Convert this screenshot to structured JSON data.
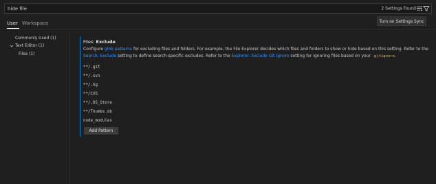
{
  "search": {
    "value": "hide file",
    "results_count": "2 Settings Found"
  },
  "tabs": [
    {
      "label": "User",
      "active": true
    },
    {
      "label": "Workspace",
      "active": false
    }
  ],
  "sync_button": {
    "label": "Turn on Settings Sync"
  },
  "toc": {
    "commonly_used": "Commonly Used (1)",
    "text_editor": "Text Editor (1)",
    "files": "Files (1)"
  },
  "setting": {
    "category": "Files: ",
    "name": "Exclude",
    "description": {
      "p1": "Configure ",
      "link1": "glob patterns",
      "p2": " for excluding files and folders. For example, the File Explorer decides which files and folders to show or hide based on this setting. Refer to the ",
      "link2": "Search: Exclude",
      "p3": " setting to define search-specific excludes. Refer to the ",
      "link3": "Explorer: Exclude Git Ignore",
      "p4": " setting for ignoring files based on your ",
      "code": ".gitignore",
      "p5": "."
    },
    "patterns": [
      "**/.git",
      "**/.svn",
      "**/.hg",
      "**/CVS",
      "**/.DS_Store",
      "**/Thumbs.db",
      "node_modules"
    ],
    "add_button": "Add Pattern"
  },
  "colors": {
    "background": "#1f1f1f",
    "link": "#3794ff",
    "modified_indicator": "#0a7aca",
    "code": "#d7ba7d"
  },
  "icons": [
    "clear-filter-icon",
    "filter-icon",
    "chevron-down-icon"
  ]
}
